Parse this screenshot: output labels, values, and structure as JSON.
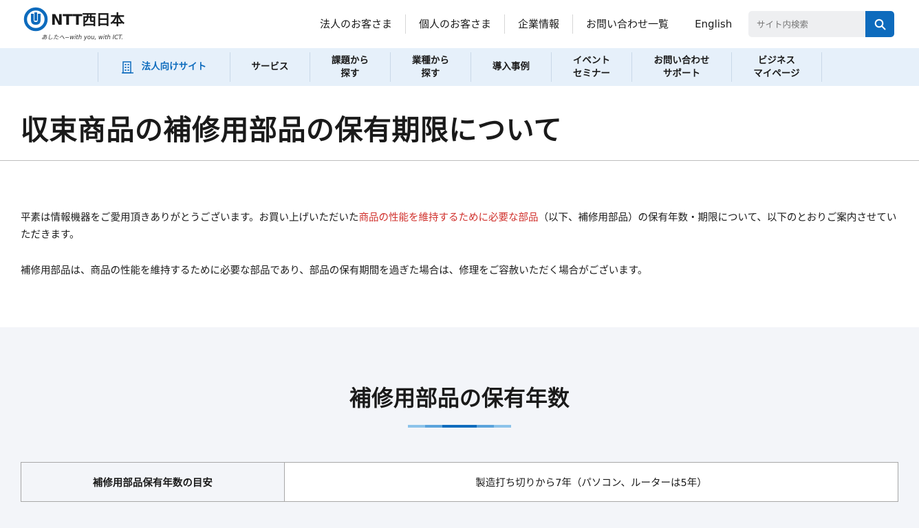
{
  "header": {
    "logo_text": "NTT西日本",
    "logo_tagline": "あしたへ−with you, with ICT.",
    "nav": [
      "法人のお客さま",
      "個人のお客さま",
      "企業情報",
      "お問い合わせ一覧",
      "English"
    ],
    "search_placeholder": "サイト内検索"
  },
  "sub_nav": {
    "items": [
      {
        "label": "法人向けサイト",
        "icon": "building-icon"
      },
      {
        "label": "サービス"
      },
      {
        "label": "課題から\n探す"
      },
      {
        "label": "業種から\n探す"
      },
      {
        "label": "導入事例"
      },
      {
        "label": "イベント\nセミナー"
      },
      {
        "label": "お問い合わせ\nサポート"
      },
      {
        "label": "ビジネス\nマイページ"
      }
    ]
  },
  "page": {
    "title": "収束商品の補修用部品の保有期限について"
  },
  "intro": {
    "p1_before": "平素は情報機器をご愛用頂きありがとうございます。お買い上げいただいた",
    "p1_highlight": "商品の性能を維持するために必要な部品",
    "p1_after": "（以下、補修用部品）の保有年数・期限について、以下のとおりご案内させていただきます。",
    "p2": "補修用部品は、商品の性能を維持するために必要な部品であり、部品の保有期間を過ぎた場合は、修理をご容赦いただく場合がございます。"
  },
  "section": {
    "title": "補修用部品の保有年数",
    "rule_colors": [
      "#8cc3ea",
      "#5aa3db",
      "#0d6bbd",
      "#5aa3db",
      "#8cc3ea"
    ],
    "table": {
      "header": "補修用部品保有年数の目安",
      "value": "製造打ち切りから7年（パソコン、ルーターは5年）"
    }
  },
  "colors": {
    "brand_blue": "#0d6bbd",
    "highlight_red": "#d0312d",
    "subnav_bg": "#e6f0fa"
  }
}
